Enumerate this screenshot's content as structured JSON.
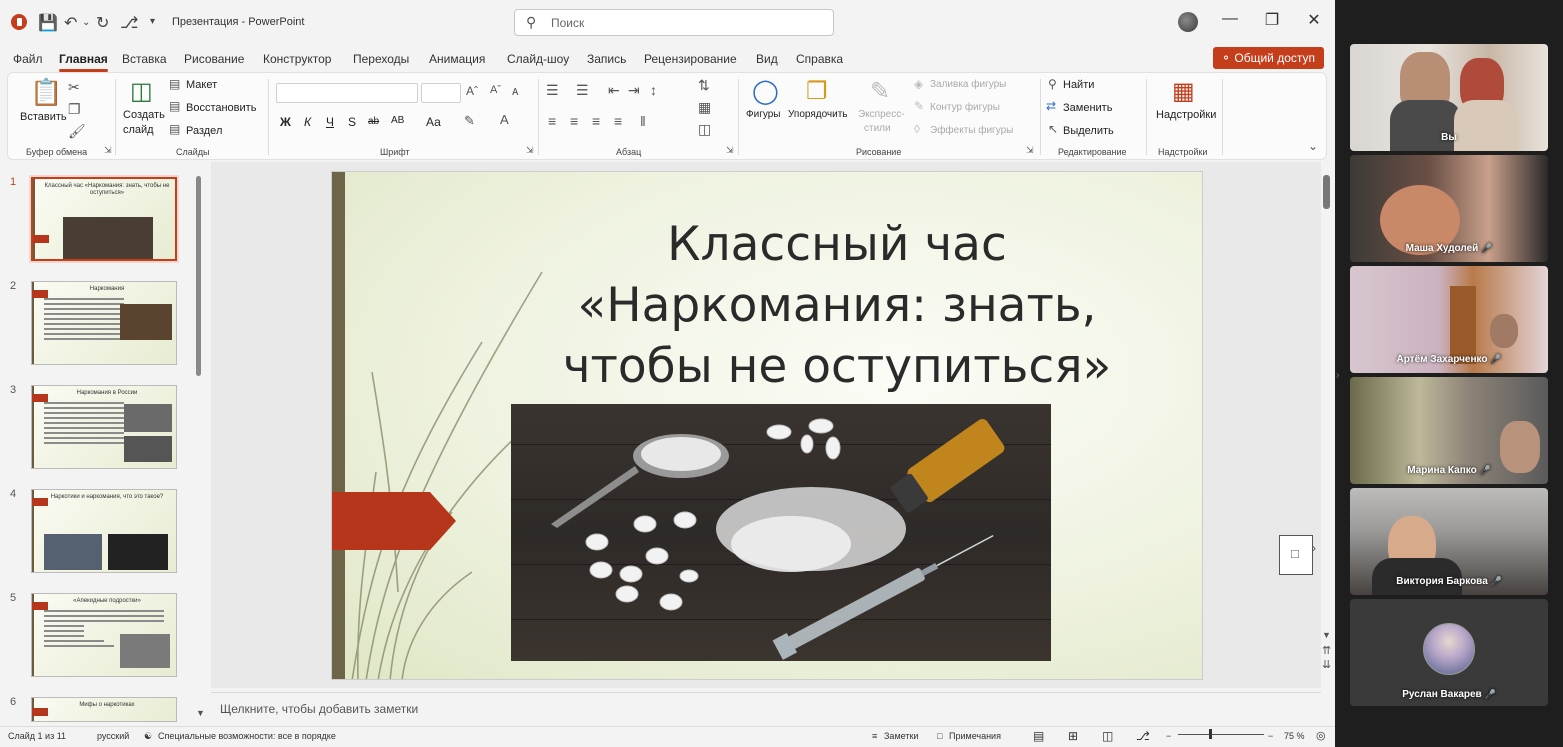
{
  "window": {
    "title": "Презентация - PowerPoint",
    "search_placeholder": "Поиск",
    "minimize": "—",
    "restore": "❐",
    "close": "✕"
  },
  "menu": {
    "tabs": [
      "Файл",
      "Главная",
      "Вставка",
      "Рисование",
      "Конструктор",
      "Переходы",
      "Анимация",
      "Слайд-шоу",
      "Запись",
      "Рецензирование",
      "Вид",
      "Справка"
    ],
    "active_tab": "Главная",
    "share": "Общий доступ"
  },
  "ribbon": {
    "clipboard": {
      "label": "Буфер обмена",
      "paste": "Вставить"
    },
    "slides": {
      "label": "Слайды",
      "new_slide_line1": "Создать",
      "new_slide_line2": "слайд",
      "layout": "Макет",
      "reset": "Восстановить",
      "section": "Раздел"
    },
    "font": {
      "label": "Шрифт",
      "bold": "Ж",
      "italic": "К",
      "underline": "Ч",
      "strike": "S",
      "spacing": "АВ",
      "case": "Аа"
    },
    "paragraph": {
      "label": "Абзац"
    },
    "drawing": {
      "label": "Рисование",
      "shapes": "Фигуры",
      "arrange": "Упорядочить",
      "styles_line1": "Экспресс-",
      "styles_line2": "стили",
      "fill": "Заливка фигуры",
      "outline": "Контур фигуры",
      "effects": "Эффекты фигуры"
    },
    "editing": {
      "label": "Редактирование",
      "find": "Найти",
      "replace": "Заменить",
      "select": "Выделить"
    },
    "addins": {
      "label": "Надстройки",
      "button": "Надстройки"
    }
  },
  "thumbnails": [
    {
      "num": "1",
      "title": "Классный час «Наркомания: знать, чтобы не оступиться»",
      "selected": true
    },
    {
      "num": "2",
      "title": "Наркомания",
      "selected": false
    },
    {
      "num": "3",
      "title": "Наркомания в России",
      "selected": false
    },
    {
      "num": "4",
      "title": "Наркотики и наркомания, что это такое?",
      "selected": false
    },
    {
      "num": "5",
      "title": "«Апекидные подростки»",
      "selected": false
    },
    {
      "num": "6",
      "title": "Мифы о наркотиках",
      "selected": false
    }
  ],
  "slide": {
    "title_line1": "Классный час",
    "title_line2": "«Наркомания: знать,",
    "title_line3": "чтобы не оступиться»",
    "accent_color": "#b5361a",
    "bar_color": "#6e6548"
  },
  "notes_placeholder": "Щелкните, чтобы добавить заметки",
  "status": {
    "slide_counter": "Слайд 1 из 11",
    "language": "русский",
    "accessibility": "Специальные возможности: все в порядке",
    "notes": "Заметки",
    "comments": "Примечания",
    "zoom": "75 %"
  },
  "participants": [
    {
      "name": "Вы",
      "muted": false
    },
    {
      "name": "Маша Худолей",
      "muted": true
    },
    {
      "name": "Артём Захарченко",
      "muted": true
    },
    {
      "name": "Марина Капко",
      "muted": true
    },
    {
      "name": "Виктория Баркова",
      "muted": true
    },
    {
      "name": "Руслан Вакарев",
      "muted": true
    }
  ],
  "colors": {
    "accent": "#c43e1c"
  }
}
